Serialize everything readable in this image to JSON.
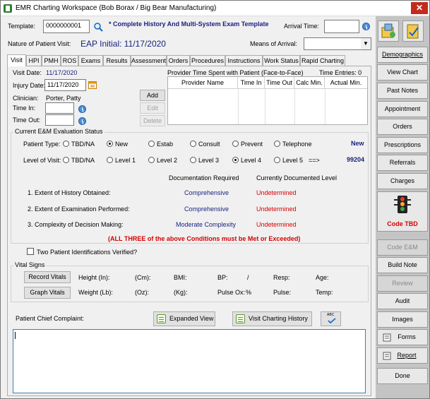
{
  "window": {
    "title": "EMR Charting Workspace (Bob Borax / Big Bear Manufacturing)",
    "close": "✕"
  },
  "header": {
    "template_label": "Template:",
    "template_value": "0000000001",
    "template_name": "* Complete History And Multi-System Exam Template",
    "arrival_time_label": "Arrival Time:",
    "arrival_time_value": "",
    "nature_label": "Nature of Patient Visit:",
    "nature_value": "EAP Initial: 11/17/2020",
    "means_label": "Means of Arrival:",
    "means_value": ""
  },
  "tabs": [
    "Visit",
    "HPI",
    "PMH",
    "ROS",
    "Exams",
    "Results",
    "Assessment",
    "Orders",
    "Procedures",
    "Instructions",
    "Work Status",
    "Rapid Charting"
  ],
  "visit": {
    "visit_date_label": "Visit Date:",
    "visit_date_value": "11/17/2020",
    "injury_date_label": "Injury Date:",
    "injury_date_value": "11/17/2020",
    "clinician_label": "Clinician:",
    "clinician_value": "Porter, Patty",
    "time_in_label": "Time In:",
    "time_out_label": "Time Out:",
    "provider_time_label": "Provider Time Spent with Patient (Face-to-Face)",
    "time_entries_label": "Time Entries: 0",
    "grid_headers": [
      "Provider Name",
      "Time In",
      "Time Out",
      "Calc Min.",
      "Actual Min."
    ],
    "add": "Add",
    "edit": "Edit",
    "delete": "Delete"
  },
  "em": {
    "group_label": "Current E&M Evaluation Status",
    "patient_type_label": "Patient Type:",
    "patient_types": [
      "TBD/NA",
      "New",
      "Estab",
      "Consult",
      "Prevent",
      "Telephone"
    ],
    "patient_type_result": "New",
    "level_label": "Level of Visit:",
    "levels": [
      "TBD/NA",
      "Level 1",
      "Level 2",
      "Level 3",
      "Level 4",
      "Level 5"
    ],
    "level_arrow": "==>",
    "level_code": "99204",
    "doc_required_header": "Documentation Required",
    "doc_current_header": "Currently Documented Level",
    "criteria": [
      {
        "label": "1.  Extent of History Obtained:",
        "required": "Comprehensive",
        "current": "Undetermined"
      },
      {
        "label": "2.  Extent of Examination Performed:",
        "required": "Comprehensive",
        "current": "Undetermined"
      },
      {
        "label": "3.  Complexity of Decision Making:",
        "required": "Moderate Complexity",
        "current": "Undetermined"
      }
    ],
    "note": "(ALL THREE of the above Conditions must be Met or Exceeded)"
  },
  "two_id_label": "Two Patient Identifications Verified?",
  "vitals": {
    "group_label": "Vital Signs",
    "record": "Record Vitals",
    "graph": "Graph Vitals",
    "row1": [
      "Height (In):",
      "(Cm):",
      "BMI:",
      "BP:",
      "/",
      "Resp:",
      "Age:"
    ],
    "row2": [
      "Weight (Lb):",
      "(Oz):",
      "(Kg):",
      "Pulse Ox:",
      "%",
      "Pulse:",
      "Temp:"
    ]
  },
  "complaint": {
    "label": "Patient Chief Complaint:",
    "expanded": "Expanded View",
    "history": "Visit Charting History",
    "spell": "ABC",
    "text": ""
  },
  "sidebar": {
    "items": [
      "Demographics",
      "View Chart",
      "Past Notes",
      "Appointment",
      "Orders",
      "Prescriptions",
      "Referrals",
      "Charges"
    ],
    "code_tbd": "Code TBD",
    "items2": [
      "Code E&M",
      "Build Note",
      "Review",
      "Audit",
      "Images",
      "Forms",
      "Report",
      "Done"
    ]
  }
}
